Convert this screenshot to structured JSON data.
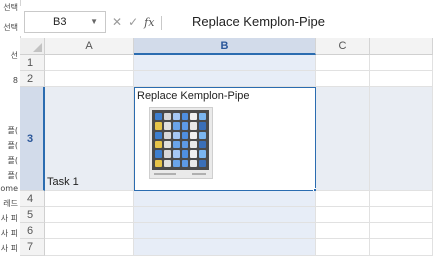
{
  "left_panel": {
    "items": [
      "선택",
      "선택",
      "선",
      "8",
      "",
      "플(",
      "플(",
      "플(",
      "플(",
      "ome",
      "레드",
      "사 피",
      "사 피",
      "사 피"
    ]
  },
  "formula_bar": {
    "name_box": "B3",
    "cancel_symbol": "✕",
    "enter_symbol": "✓",
    "fx_symbol": "fx",
    "content": "Replace Kemplon-Pipe"
  },
  "grid": {
    "columns": [
      "A",
      "B",
      "C"
    ],
    "selected_column": "B",
    "rows": [
      "1",
      "2",
      "3",
      "4",
      "5",
      "6",
      "7"
    ],
    "selected_row": "3",
    "cells": {
      "A3": "Task 1",
      "B3": "Replace Kemplon-Pipe"
    },
    "embedded_image": {
      "icon": "desktop-screenshot-thumbnail",
      "tile_colors": [
        "#4f8fe0",
        "#e8e8e8",
        "#7bb6f0",
        "#3d7fd0",
        "#e0e0e0",
        "#a5c8f5",
        "#5d9ae6",
        "#f0f0f0",
        "#3a6fb8",
        "#e6c44a",
        "#d9d9d9",
        "#6aa4ea"
      ]
    }
  },
  "colors": {
    "selection_border": "#2b6cb0",
    "selected_header_bg": "#d2dbea",
    "selected_column_fill": "#e7edf7"
  }
}
